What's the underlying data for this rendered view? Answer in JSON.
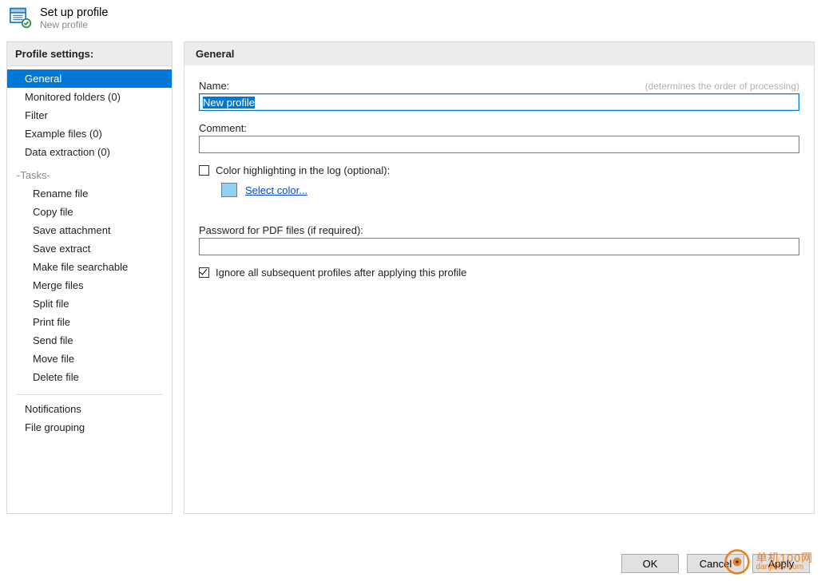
{
  "header": {
    "title": "Set up profile",
    "subtitle": "New profile"
  },
  "left": {
    "heading": "Profile settings:",
    "items": [
      "General",
      "Monitored folders (0)",
      "Filter",
      "Example files (0)",
      "Data extraction (0)"
    ],
    "tasks_label": "-Tasks-",
    "tasks": [
      "Rename file",
      "Copy file",
      "Save attachment",
      "Save extract",
      "Make file searchable",
      "Merge files",
      "Split file",
      "Print file",
      "Send file",
      "Move file",
      "Delete file"
    ],
    "after": [
      "Notifications",
      "File grouping"
    ]
  },
  "right": {
    "heading": "General",
    "name_label": "Name:",
    "name_hint": "(determines the order of processing)",
    "name_value": "New profile",
    "comment_label": "Comment:",
    "comment_value": "",
    "color_chk_label": "Color highlighting in the log (optional):",
    "color_chk_checked": false,
    "select_color_link": "Select color...",
    "swatch_color": "#8fd3f2",
    "password_label": "Password for PDF files (if required):",
    "password_value": "",
    "ignore_chk_label": "Ignore all subsequent profiles after applying this profile",
    "ignore_chk_checked": true
  },
  "footer": {
    "ok": "OK",
    "cancel": "Cancel",
    "apply": "Apply"
  },
  "watermark": {
    "line1": "单机100网",
    "line2": "danji100.com"
  }
}
